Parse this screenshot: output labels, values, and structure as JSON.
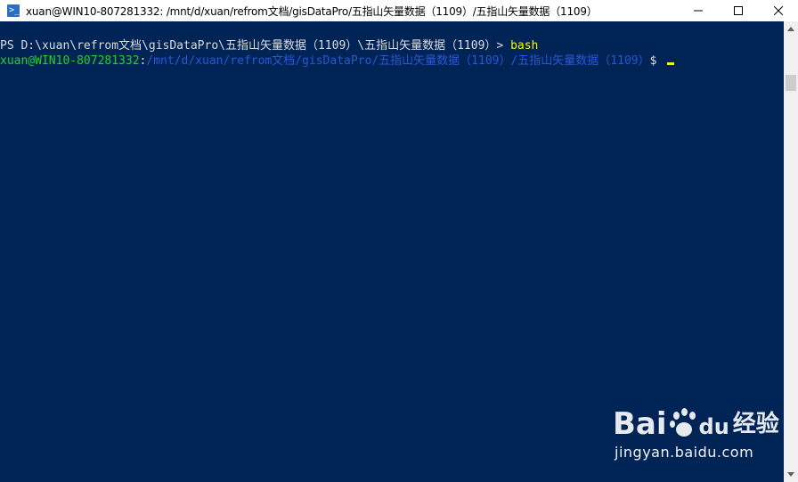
{
  "window": {
    "title": "xuan@WIN10-807281332: /mnt/d/xuan/refrom文档/gisDataPro/五指山矢量数据（1109）/五指山矢量数据（1109）",
    "minimize_icon": "minimize-icon",
    "maximize_icon": "maximize-icon",
    "close_icon": "close-icon"
  },
  "terminal": {
    "line1_prompt": "PS D:\\xuan\\refrom文档\\gisDataPro\\五指山矢量数据（1109）\\五指山矢量数据（1109）> ",
    "line1_command": "bash",
    "line2_user": "xuan@WIN10-807281332",
    "line2_colon": ":",
    "line2_path": "/mnt/d/xuan/refrom文档/gisDataPro/五指山矢量数据（1109）/五指山矢量数据（1109）",
    "line2_dollar": "$ "
  },
  "watermark": {
    "logo_bai": "Bai",
    "logo_du": "du",
    "logo_jingyan": "经验",
    "url": "jingyan.baidu.com"
  },
  "colors": {
    "console_bg": "#012456",
    "prompt_text": "#dcdcdc",
    "command": "#f6f61a",
    "user_host": "#23d223",
    "path": "#2a57d8"
  }
}
